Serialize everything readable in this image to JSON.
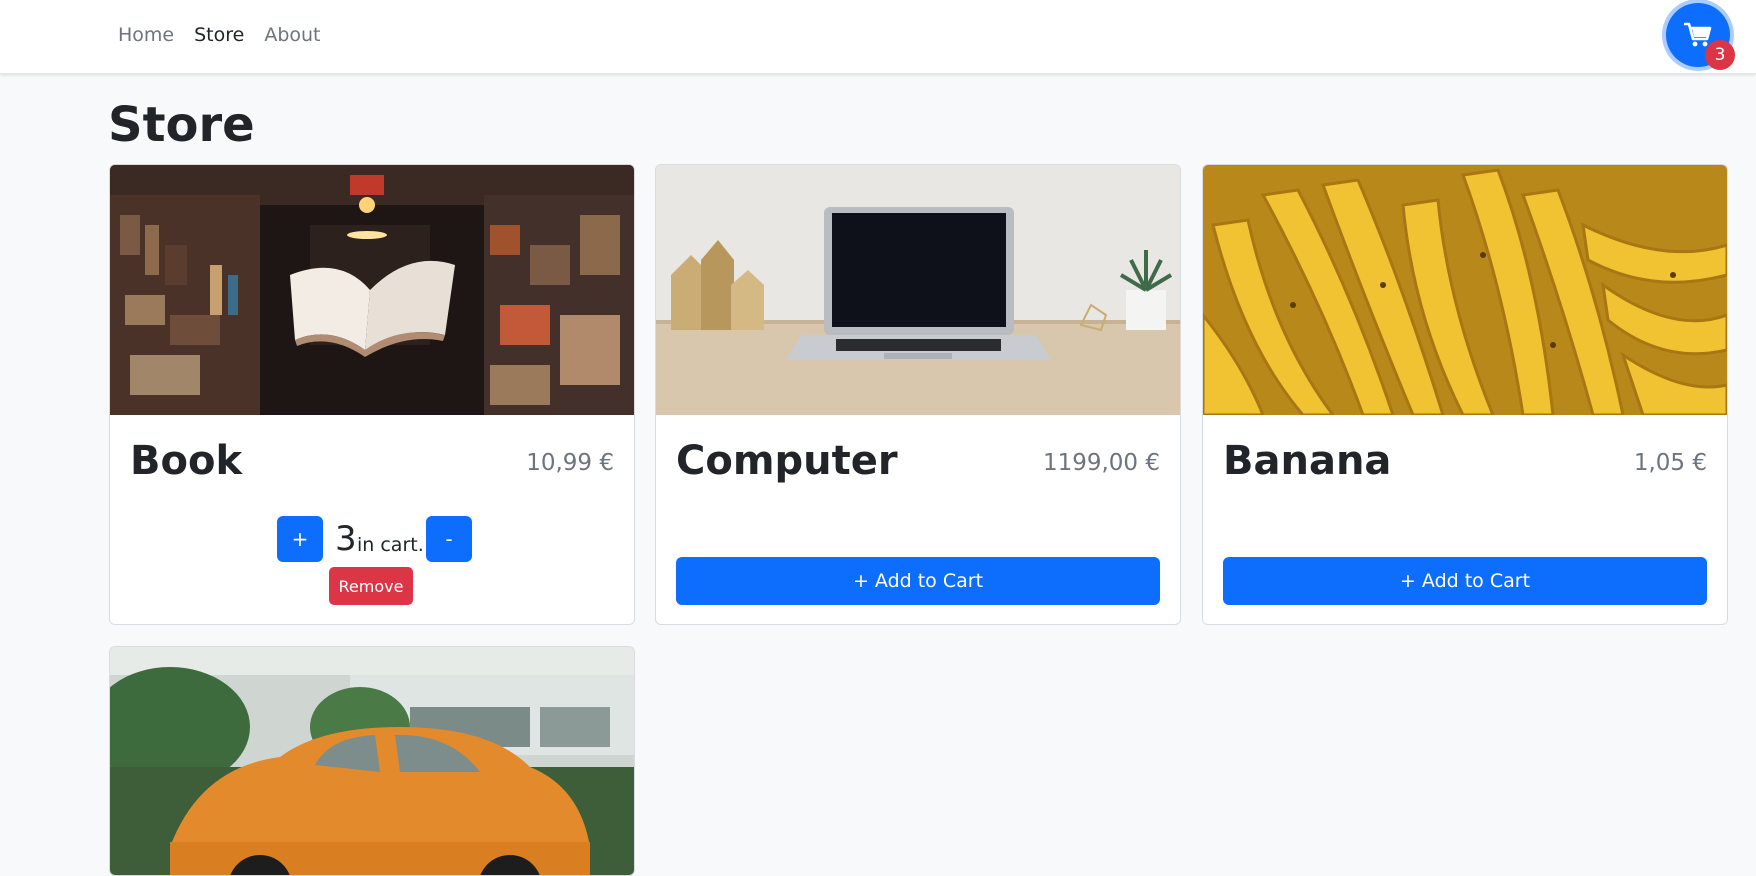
{
  "nav": {
    "links": [
      {
        "label": "Home",
        "active": false
      },
      {
        "label": "Store",
        "active": true
      },
      {
        "label": "About",
        "active": false
      }
    ],
    "cart_count": "3"
  },
  "page": {
    "title": "Store"
  },
  "products": [
    {
      "name": "Book",
      "price": "10,99 €",
      "image": "book-photo",
      "in_cart": true,
      "quantity": "3",
      "in_cart_label": "in cart.",
      "plus_label": "+",
      "minus_label": "-",
      "remove_label": "Remove"
    },
    {
      "name": "Computer",
      "price": "1199,00 €",
      "image": "laptop-photo",
      "in_cart": false,
      "add_label": "+ Add to Cart"
    },
    {
      "name": "Banana",
      "price": "1,05 €",
      "image": "banana-photo",
      "in_cart": false,
      "add_label": "+ Add to Cart"
    },
    {
      "image": "car-photo"
    }
  ],
  "colors": {
    "primary": "#0d6efd",
    "danger": "#dc3545",
    "muted": "#6c757d",
    "background": "#f8f9fa"
  }
}
